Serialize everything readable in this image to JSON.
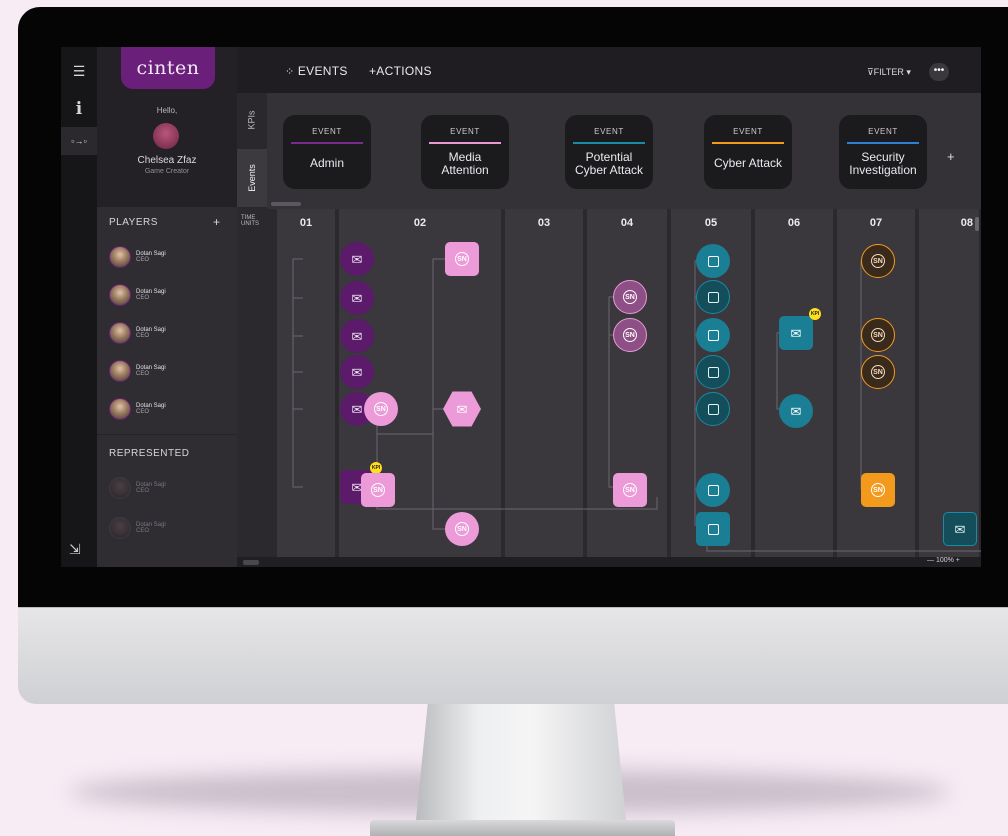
{
  "app": {
    "logo": "cinten"
  },
  "profile": {
    "greeting": "Hello,",
    "name": "Chelsea Zfaz",
    "role": "Game Creator"
  },
  "rail": {
    "menu_icon": "☰",
    "info_icon": "i",
    "flow_icon": "▫→▫",
    "export_icon": "⇲"
  },
  "topbar": {
    "events_label": "EVENTS",
    "actions_label": "+ACTIONS",
    "filter_label": "FILTER ▾",
    "more_label": "•••"
  },
  "tabs": {
    "kpis": "KPIs",
    "events": "Events"
  },
  "events": [
    {
      "tag": "EVENT",
      "title": "Admin",
      "color": "#7a2a8c"
    },
    {
      "tag": "EVENT",
      "title": "Media\nAttention",
      "color": "#e99ad6"
    },
    {
      "tag": "EVENT",
      "title": "Potential\nCyber Attack",
      "color": "#1a8aa6"
    },
    {
      "tag": "EVENT",
      "title": "Cyber Attack",
      "color": "#f39a1c"
    },
    {
      "tag": "EVENT",
      "title": "Security\nInvestigation",
      "color": "#2f7fd6"
    }
  ],
  "players": {
    "header": "PLAYERS",
    "add": "+",
    "items": [
      {
        "name": "Dotan Sagi",
        "role": "CEO"
      },
      {
        "name": "Dotan Sagi",
        "role": "CEO"
      },
      {
        "name": "Dotan Sagi",
        "role": "CEO"
      },
      {
        "name": "Dotan Sagi",
        "role": "CEO"
      },
      {
        "name": "Dotan Sagi",
        "role": "CEO"
      }
    ]
  },
  "represented": {
    "header": "REPRESENTED",
    "items": [
      {
        "name": "Dotan Sagi",
        "role": "CEO"
      },
      {
        "name": "Dotan Sagi",
        "role": "CEO"
      }
    ]
  },
  "timeline": {
    "units_label": "TIME\nUNITS",
    "columns": [
      "01",
      "02",
      "03",
      "04",
      "05",
      "06",
      "07",
      "08"
    ],
    "kpi_label": "KPI",
    "zoom": "100%"
  },
  "colors": {
    "purple": "#6a1f7a",
    "pink": "#e99ad6",
    "teal": "#1a7f95",
    "orange": "#f39a1c"
  }
}
